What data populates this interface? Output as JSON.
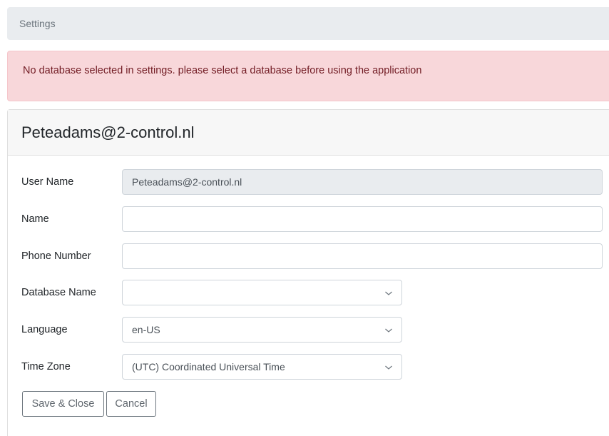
{
  "breadcrumb": {
    "label": "Settings"
  },
  "alert": {
    "message": "No database selected in settings. please select a database before using the application"
  },
  "card": {
    "title": "Peteadams@2-control.nl"
  },
  "form": {
    "user_name": {
      "label": "User Name",
      "value": "Peteadams@2-control.nl"
    },
    "name": {
      "label": "Name",
      "value": ""
    },
    "phone": {
      "label": "Phone Number",
      "value": ""
    },
    "database": {
      "label": "Database Name",
      "value": ""
    },
    "language": {
      "label": "Language",
      "value": "en-US"
    },
    "timezone": {
      "label": "Time Zone",
      "value": "(UTC) Coordinated Universal Time"
    }
  },
  "buttons": {
    "save": "Save & Close",
    "cancel": "Cancel"
  },
  "icons": {
    "select_arrow": "chevron-down-icon"
  }
}
